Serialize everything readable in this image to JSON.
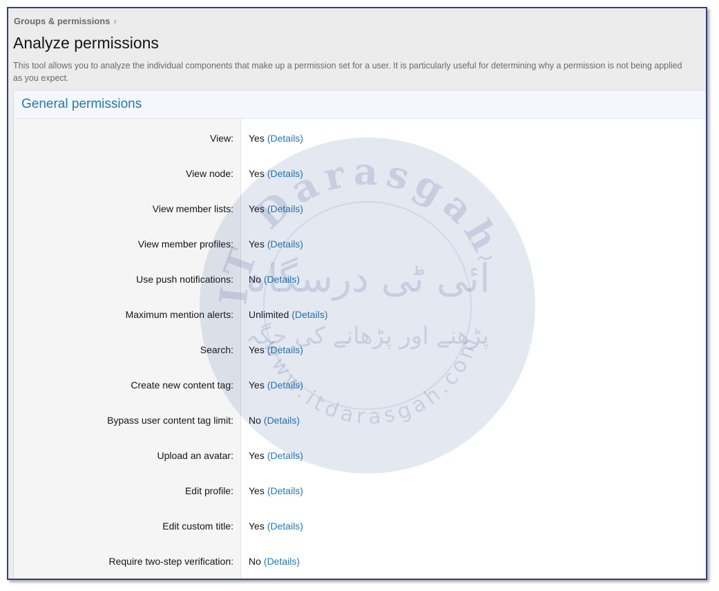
{
  "breadcrumb": {
    "items": [
      "Groups & permissions"
    ],
    "separator": "›"
  },
  "page": {
    "title": "Analyze permissions",
    "description": "This tool allows you to analyze the individual components that make up a permission set for a user. It is particularly useful for determining why a permission is not being applied as you expect."
  },
  "section": {
    "title": "General permissions",
    "details_label": "(Details)",
    "rows": [
      {
        "label": "View:",
        "value": "Yes"
      },
      {
        "label": "View node:",
        "value": "Yes"
      },
      {
        "label": "View member lists:",
        "value": "Yes"
      },
      {
        "label": "View member profiles:",
        "value": "Yes"
      },
      {
        "label": "Use push notifications:",
        "value": "No"
      },
      {
        "label": "Maximum mention alerts:",
        "value": "Unlimited"
      },
      {
        "label": "Search:",
        "value": "Yes"
      },
      {
        "label": "Create new content tag:",
        "value": "Yes"
      },
      {
        "label": "Bypass user content tag limit:",
        "value": "No"
      },
      {
        "label": "Upload an avatar:",
        "value": "Yes"
      },
      {
        "label": "Edit profile:",
        "value": "Yes"
      },
      {
        "label": "Edit custom title:",
        "value": "Yes"
      },
      {
        "label": "Require two-step verification:",
        "value": "No"
      }
    ]
  },
  "watermark": {
    "latin_arc": "IT Darasgah",
    "urdu_main": "آئی ٹی درسگاہ",
    "urdu_sub": "پڑھنے اور پڑھانے کی جگہ",
    "url": "www.itdarasgah.com"
  },
  "colors": {
    "link": "#2577b1",
    "section_title": "#2577b1",
    "frame_border": "#2f3f86",
    "watermark": "#2f4a8a"
  }
}
